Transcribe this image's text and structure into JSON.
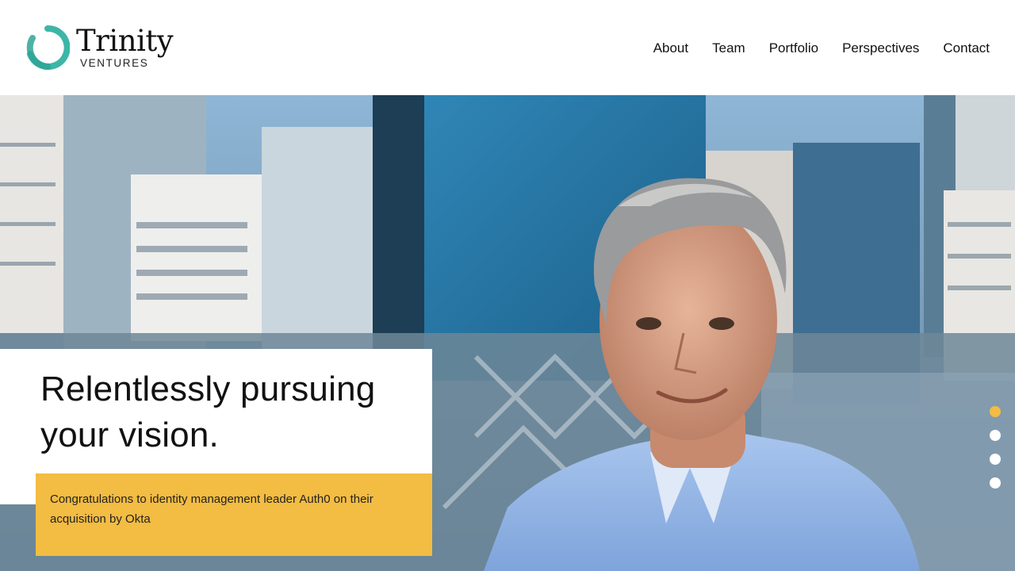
{
  "brand": {
    "name": "Trinity",
    "subtitle": "VENTURES",
    "logo_icon": "trinity-swirl-logo-icon",
    "colors": {
      "logo_teal": "#3cb6a7",
      "accent_yellow": "#f3bc42",
      "text": "#111111"
    }
  },
  "nav": {
    "items": [
      {
        "label": "About"
      },
      {
        "label": "Team"
      },
      {
        "label": "Portfolio"
      },
      {
        "label": "Perspectives"
      },
      {
        "label": "Contact"
      }
    ]
  },
  "hero": {
    "headline": "Relentlessly pursuing your vision.",
    "news": "Congratulations to identity management leader Auth0 on their acquisition by Okta",
    "slides": {
      "count": 4,
      "active_index": 0
    }
  }
}
